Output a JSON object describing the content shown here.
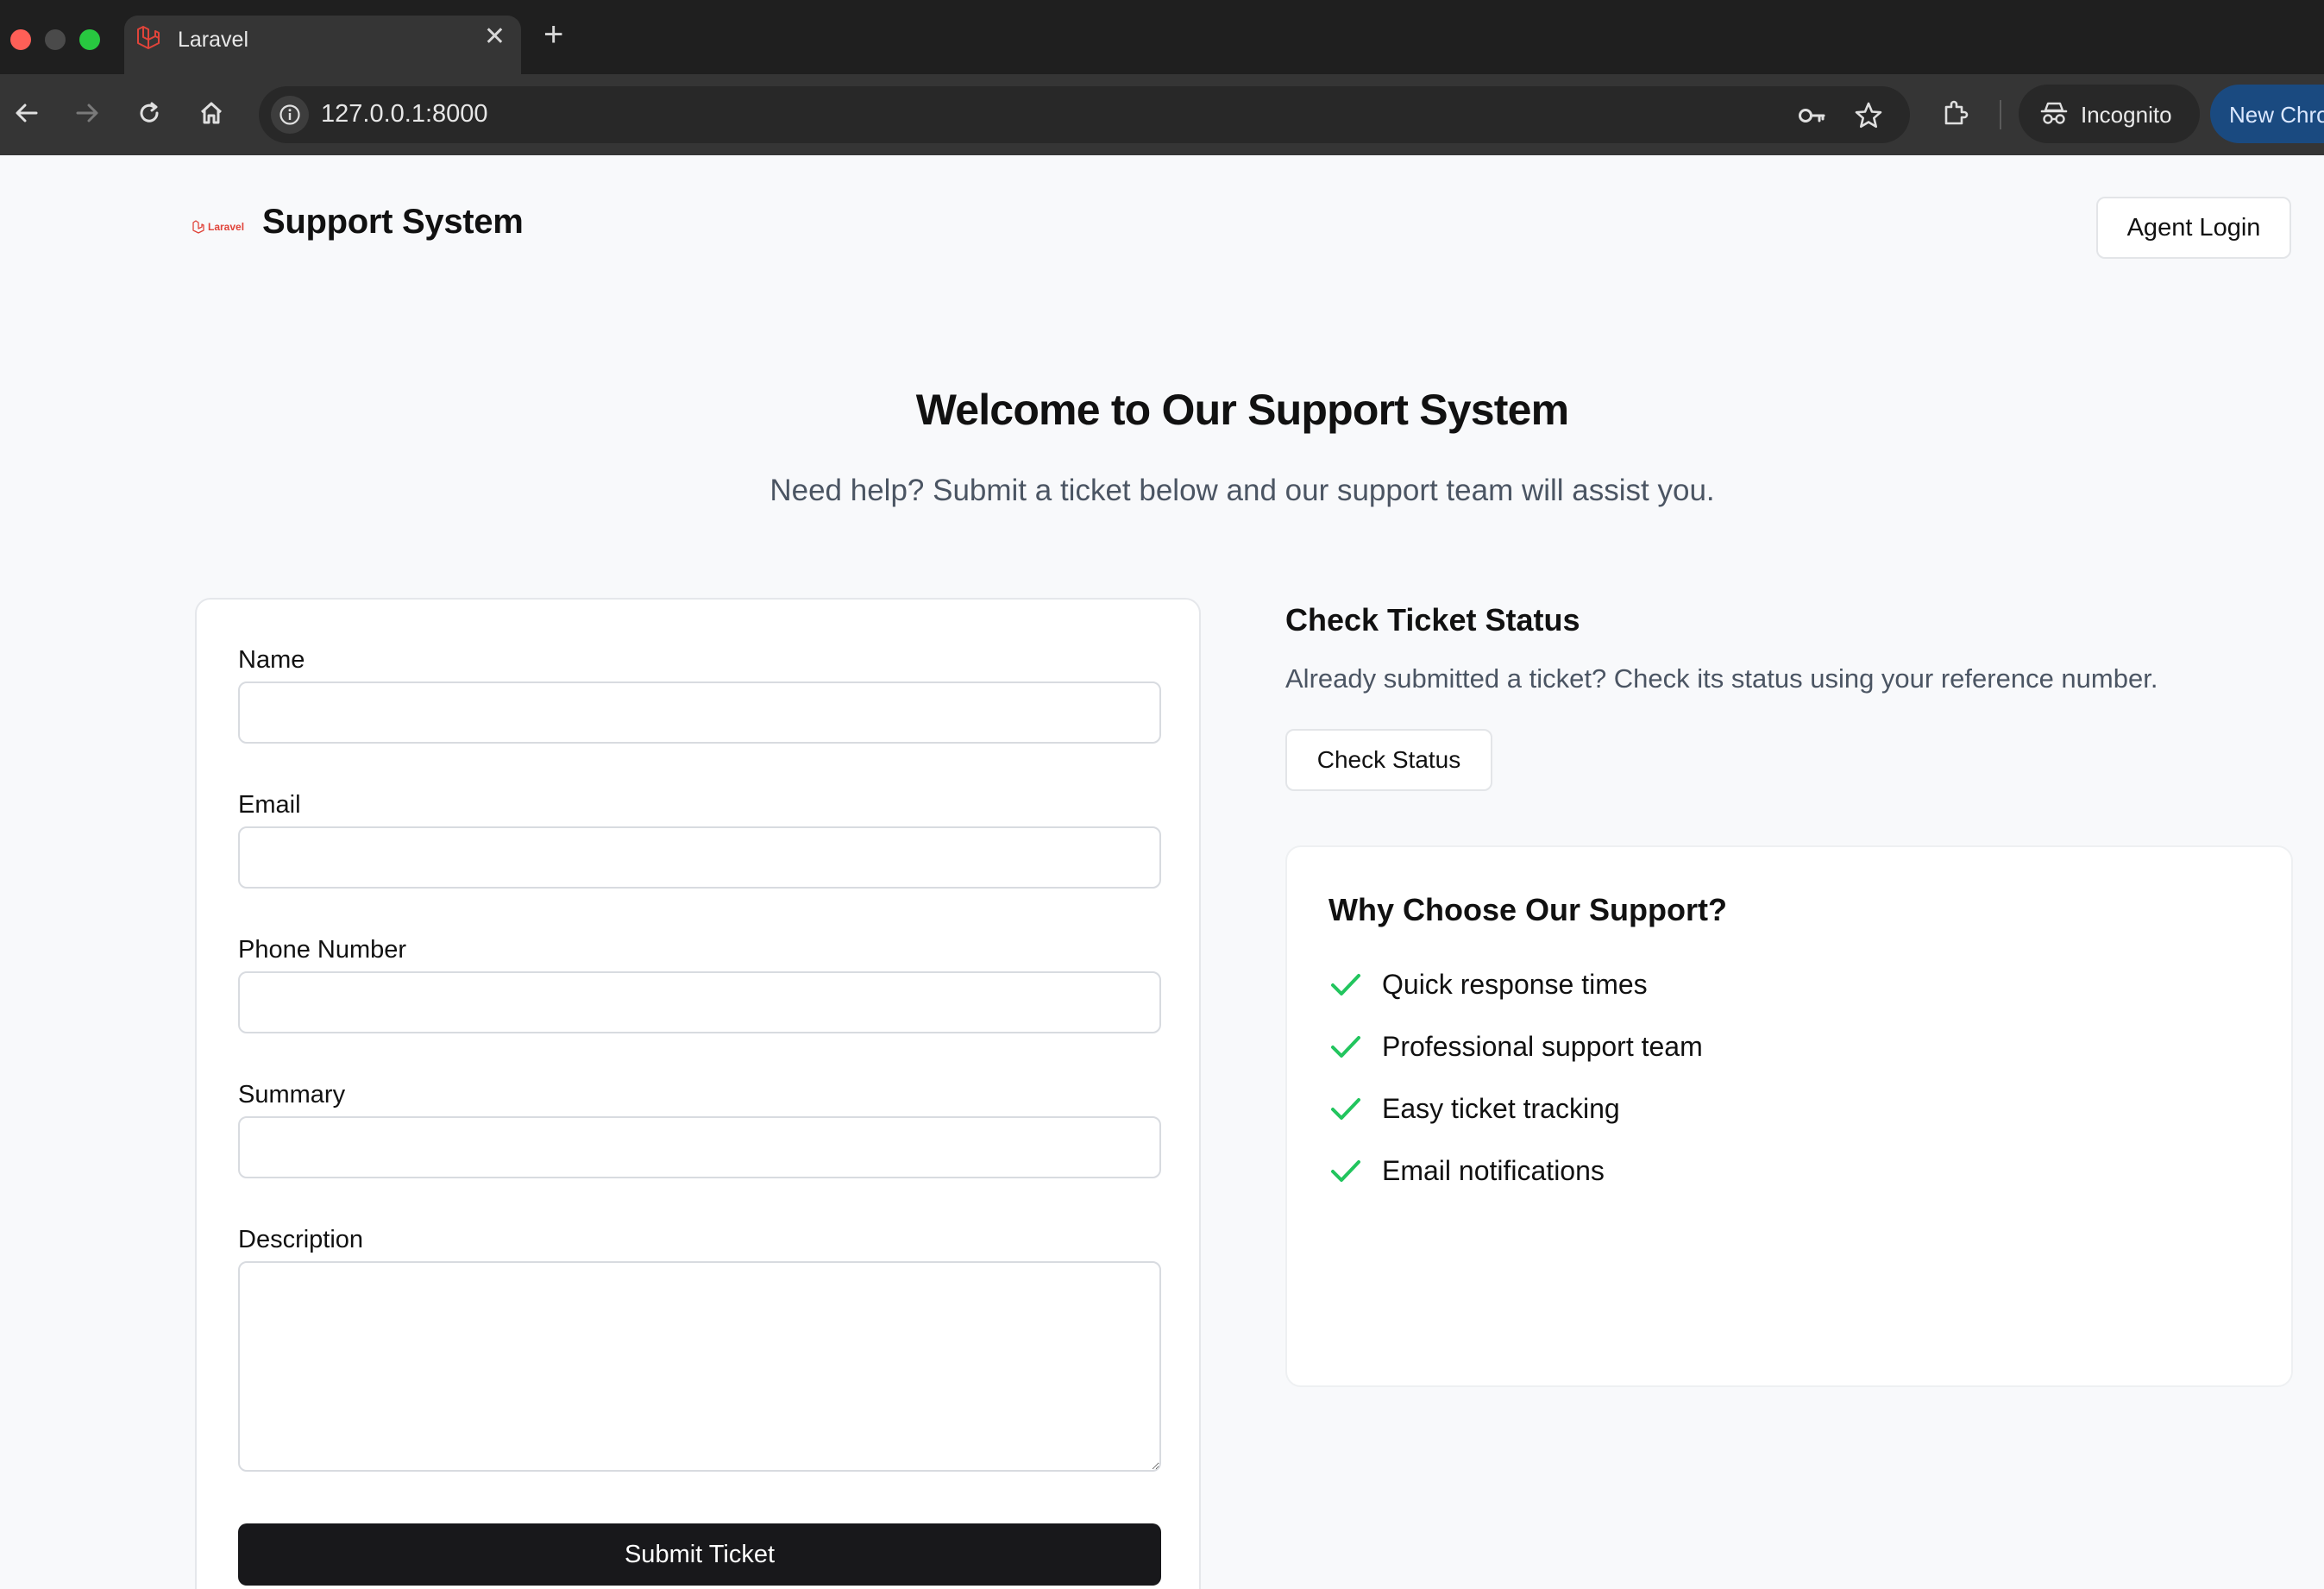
{
  "browser": {
    "tab_title": "Laravel",
    "url": "127.0.0.1:8000",
    "incognito_label": "Incognito",
    "new_chrome_label": "New Chrome available"
  },
  "header": {
    "logo_text": "Laravel",
    "brand": "Support System",
    "agent_login": "Agent Login"
  },
  "hero": {
    "title": "Welcome to Our Support System",
    "subtitle": "Need help? Submit a ticket below and our support team will assist you."
  },
  "form": {
    "fields": [
      {
        "label": "Name",
        "value": ""
      },
      {
        "label": "Email",
        "value": ""
      },
      {
        "label": "Phone Number",
        "value": ""
      },
      {
        "label": "Summary",
        "value": ""
      },
      {
        "label": "Description",
        "value": ""
      }
    ],
    "submit_label": "Submit Ticket"
  },
  "status": {
    "title": "Check Ticket Status",
    "description": "Already submitted a ticket? Check its status using your reference number.",
    "button": "Check Status"
  },
  "why": {
    "title": "Why Choose Our Support?",
    "items": [
      "Quick response times",
      "Professional support team",
      "Easy ticket tracking",
      "Email notifications"
    ],
    "check_color": "#22c55e"
  }
}
